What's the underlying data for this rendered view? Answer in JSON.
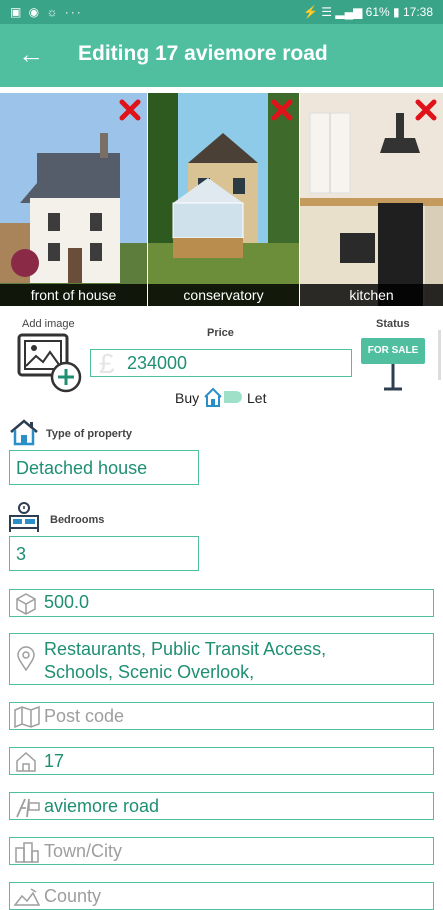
{
  "status_bar": {
    "left_icons": "▣ ◉ ☼ ···",
    "battery": "61%",
    "time": "17:38"
  },
  "header": {
    "title": "Editing 17 aviemore road"
  },
  "gallery": [
    {
      "caption": "front of house"
    },
    {
      "caption": "conservatory"
    },
    {
      "caption": "kitchen"
    }
  ],
  "add_image_label": "Add image",
  "price": {
    "label": "Price",
    "currency": "£",
    "value": "234000"
  },
  "toggle": {
    "buy": "Buy",
    "let": "Let"
  },
  "status": {
    "label": "Status",
    "sign": "FOR SALE"
  },
  "property_type": {
    "label": "Type of property",
    "value": "Detached house"
  },
  "bedrooms": {
    "label": "Bedrooms",
    "value": "3"
  },
  "area": {
    "value": "500.0"
  },
  "amenities": {
    "line1": "Restaurants, Public Transit Access,",
    "line2": "Schools, Scenic Overlook,"
  },
  "postcode": {
    "placeholder": "Post code"
  },
  "house_number": {
    "value": "17"
  },
  "street": {
    "value": "aviemore road"
  },
  "town": {
    "placeholder": "Town/City"
  },
  "county": {
    "placeholder": "County"
  },
  "colors": {
    "accent": "#4fbf9f",
    "status_bar": "#3aa488",
    "text": "#1f8f72",
    "delete": "#e0131a"
  }
}
